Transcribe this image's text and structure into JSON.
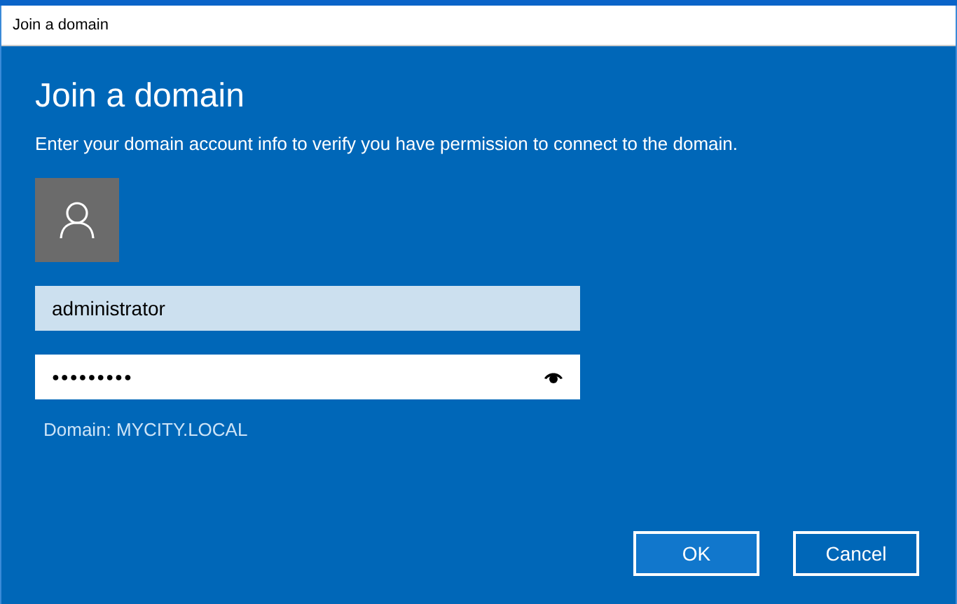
{
  "window": {
    "title": "Join a domain"
  },
  "heading": "Join a domain",
  "description": "Enter your domain account info to verify you have permission to connect to the domain.",
  "fields": [
    {
      "kind": "text",
      "value": "administrator"
    },
    {
      "kind": "password",
      "value": "●●●●●●●●●"
    }
  ],
  "domain_label": "Domain: MYCITY.LOCAL",
  "buttons": [
    {
      "label": "OK",
      "default": true
    },
    {
      "label": "Cancel",
      "default": false
    }
  ]
}
